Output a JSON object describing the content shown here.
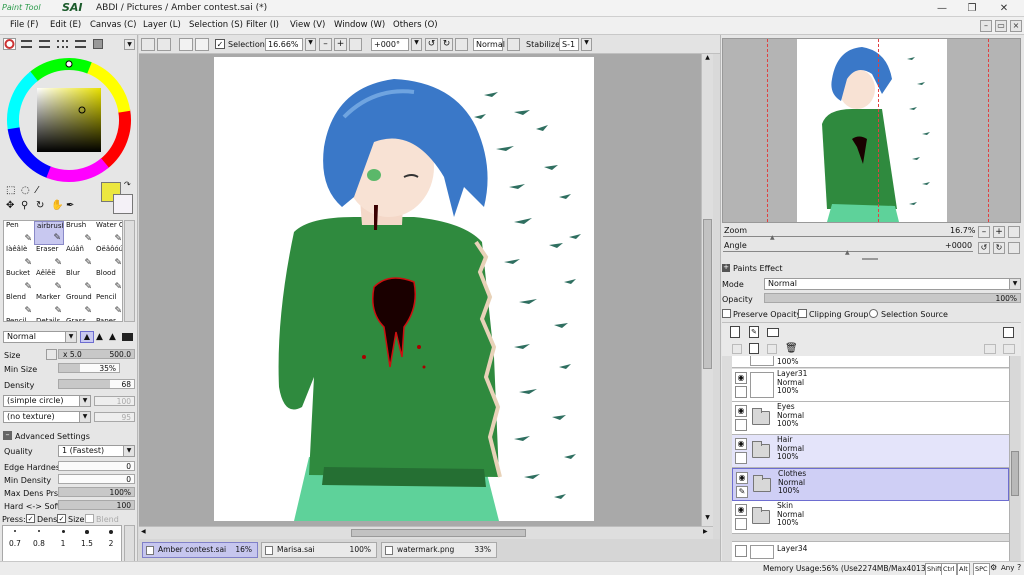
{
  "app": {
    "logo_small": "Paint Tool",
    "logo_big": "SAI",
    "title": "ABDI / Pictures / Amber contest.sai (*)"
  },
  "window_buttons": [
    "—",
    "❐",
    "✕"
  ],
  "menu": [
    "File (F)",
    "Edit (E)",
    "Canvas (C)",
    "Layer (L)",
    "Selection (S)",
    "Filter (I)",
    "View (V)",
    "Window (W)",
    "Others (O)"
  ],
  "canvas_toolbar": {
    "selection_label": "Selection",
    "zoom": "16.66%",
    "rotation": "+000°",
    "blend": "Normal",
    "stabilizer_label": "Stabilizer",
    "stabilizer_value": "S-1"
  },
  "colors": {
    "primary": "#ece740",
    "secondary": "#f4f1f7",
    "selection_tint": "#c8c8f0",
    "hair": "#3a78c8",
    "shirt": "#2f8a3e",
    "skirt": "#5ed29a"
  },
  "tools": [
    {
      "label": "Pen",
      "icon": "pen-icon"
    },
    {
      "label": "airbrush",
      "icon": "airbrush-icon"
    },
    {
      "label": "Brush",
      "icon": "brush-icon"
    },
    {
      "label": "Water C",
      "icon": "watercolor-icon"
    },
    {
      "label": "ÌàêâÎè",
      "icon": "pencil-icon"
    },
    {
      "label": "Eraser",
      "icon": "eraser-icon"
    },
    {
      "label": "Àúâñ",
      "icon": "smudge-icon"
    },
    {
      "label": "Óëâôóú",
      "icon": "blur-icon"
    },
    {
      "label": "Bucket",
      "icon": "bucket-icon"
    },
    {
      "label": "Äêïêë",
      "icon": "dodge-icon"
    },
    {
      "label": "Blur",
      "icon": "blur-drop-icon"
    },
    {
      "label": "Blood",
      "icon": "blood-icon"
    },
    {
      "label": "Blend",
      "icon": "blend-icon"
    },
    {
      "label": "Marker",
      "icon": "marker-icon"
    },
    {
      "label": "Ground",
      "icon": "ground-icon"
    },
    {
      "label": "Pencil",
      "icon": "pencil2-icon"
    },
    {
      "label": "Pencil",
      "icon": "pencil3-icon"
    },
    {
      "label": "Details",
      "icon": "details-icon"
    },
    {
      "label": "Grass",
      "icon": "grass-icon"
    },
    {
      "label": "Paper",
      "icon": "paper-icon"
    }
  ],
  "brush": {
    "mode": "Normal",
    "size_label": "Size",
    "size_multiplier": "x 5.0",
    "size_value": "500.0",
    "min_size_label": "Min Size",
    "min_size_value": "35%",
    "min_size_fraction": 0.35,
    "density_label": "Density",
    "density_value": "68",
    "density_fraction": 0.68,
    "shape": "(simple circle)",
    "shape_value": "100",
    "texture": "(no texture)",
    "texture_value": "95",
    "advanced_label": "Advanced Settings",
    "quality_label": "Quality",
    "quality_value": "1 (Fastest)",
    "edge_label": "Edge Hardness",
    "edge_value": "0",
    "min_density_label": "Min Density",
    "min_density_value": "0",
    "max_dens_label": "Max Dens Prs.",
    "max_dens_value": "100%",
    "hard_soft_label": "Hard <-> Soft",
    "hard_soft_value": "100",
    "press_label": "Press:",
    "press_dens": "Dens",
    "press_size": "Size",
    "press_blend": "Blend",
    "presets": [
      "0.7",
      "0.8",
      "1",
      "1.5",
      "2"
    ]
  },
  "navigator": {
    "zoom_label": "Zoom",
    "zoom_value": "16.7%",
    "angle_label": "Angle",
    "angle_value": "+0000"
  },
  "layer_panel": {
    "paints_effect": "Paints Effect",
    "mode_label": "Mode",
    "mode_value": "Normal",
    "opacity_label": "Opacity",
    "opacity_value": "100%",
    "preserve_opacity": "Preserve Opacity",
    "clipping_group": "Clipping Group",
    "selection_source": "Selection Source",
    "partial_top": "100%",
    "layers": [
      {
        "name": "Layer31",
        "mode": "Normal",
        "opacity": "100%",
        "type": "layer",
        "state": "plain"
      },
      {
        "name": "Eyes",
        "mode": "Normal",
        "opacity": "100%",
        "type": "folder",
        "state": "plain"
      },
      {
        "name": "Hair",
        "mode": "Normal",
        "opacity": "100%",
        "type": "folder",
        "state": "tint"
      },
      {
        "name": "Clothes",
        "mode": "Normal",
        "opacity": "100%",
        "type": "folder",
        "state": "sel"
      },
      {
        "name": "Skin",
        "mode": "Normal",
        "opacity": "100%",
        "type": "folder",
        "state": "plain"
      }
    ],
    "partial_bottom": "Layer34"
  },
  "tabs": [
    {
      "name": "Amber contest.sai",
      "pct": "16%",
      "active": true
    },
    {
      "name": "Marisa.sai",
      "pct": "100%",
      "active": false
    },
    {
      "name": "watermark.png",
      "pct": "33%",
      "active": false
    }
  ],
  "status": {
    "memory": "Memory Usage:56% (Use2274MB/Max4013MB)",
    "keys": [
      "Shift",
      "Ctrl",
      "Alt",
      "SPC"
    ],
    "any": "Any"
  }
}
